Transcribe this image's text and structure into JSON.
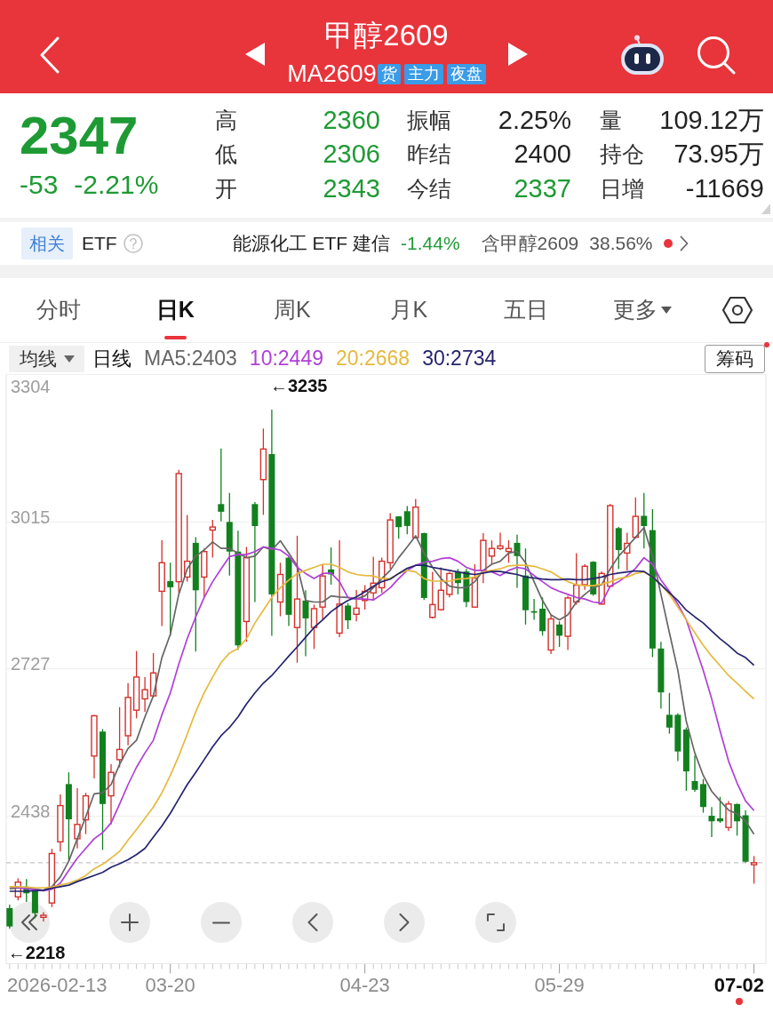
{
  "header": {
    "title": "甲醇2609",
    "code": "MA2609",
    "badges": [
      "货",
      "主力",
      "夜盘"
    ]
  },
  "quote": {
    "price": "2347",
    "change": "-53",
    "change_pct": "-2.21%",
    "down": true,
    "stats": [
      {
        "label": "高",
        "value": "2360",
        "color": "#1e9a34"
      },
      {
        "label": "振幅",
        "value": "2.25%",
        "color": "#222222"
      },
      {
        "label": "量",
        "value": "109.12万",
        "color": "#222222"
      },
      {
        "label": "低",
        "value": "2306",
        "color": "#1e9a34"
      },
      {
        "label": "昨结",
        "value": "2400",
        "color": "#222222"
      },
      {
        "label": "持仓",
        "value": "73.95万",
        "color": "#222222"
      },
      {
        "label": "开",
        "value": "2343",
        "color": "#1e9a34"
      },
      {
        "label": "今结",
        "value": "2337",
        "color": "#1e9a34"
      },
      {
        "label": "日增",
        "value": "-11669",
        "color": "#222222"
      }
    ]
  },
  "etf": {
    "tag": "相关",
    "label": "ETF",
    "fund": "能源化工 ETF 建信",
    "change": "-1.44%",
    "down": true,
    "holding": "含甲醇2609",
    "weight": "38.56%",
    "alert": true
  },
  "tabs": [
    {
      "label": "分时",
      "selected": false,
      "kind": "tab"
    },
    {
      "label": "日K",
      "selected": true,
      "kind": "tab"
    },
    {
      "label": "周K",
      "selected": false,
      "kind": "tab"
    },
    {
      "label": "月K",
      "selected": false,
      "kind": "tab"
    },
    {
      "label": "五日",
      "selected": false,
      "kind": "tab"
    },
    {
      "label": "更多",
      "selected": false,
      "kind": "menu"
    }
  ],
  "chart": {
    "selector": "均线",
    "period": "日线",
    "chip_button": {
      "label": "筹码",
      "alert": true
    },
    "start_date": "2026-02-13",
    "end_date": "07-02",
    "current_marker": true,
    "controls": [
      {
        "kind": "rewind"
      },
      {
        "kind": "zoom-in"
      },
      {
        "kind": "zoom-out"
      },
      {
        "kind": "back"
      },
      {
        "kind": "forward"
      },
      {
        "kind": "fullscreen"
      }
    ],
    "chart_data": {
      "type": "candlestick",
      "grid": true,
      "ylim": [
        2149,
        3304
      ],
      "yticks": [
        3304,
        3015,
        2727,
        2438
      ],
      "categories": [
        null,
        null,
        null,
        null,
        null,
        null,
        null,
        null,
        null,
        null,
        null,
        null,
        null,
        null,
        null,
        null,
        null,
        null,
        null,
        "03-20",
        null,
        null,
        null,
        null,
        null,
        null,
        null,
        null,
        null,
        null,
        null,
        null,
        null,
        null,
        null,
        null,
        null,
        null,
        null,
        null,
        null,
        null,
        "04-23",
        null,
        null,
        null,
        null,
        null,
        null,
        null,
        null,
        null,
        null,
        null,
        null,
        null,
        null,
        null,
        null,
        null,
        null,
        null,
        null,
        null,
        null,
        "05-29",
        null,
        null,
        null,
        null,
        null,
        null,
        null,
        null,
        null,
        null,
        null,
        null,
        null,
        null,
        null,
        null,
        null,
        null,
        null,
        null,
        null,
        null,
        null
      ],
      "annotations": [
        "←3235",
        "←2218"
      ],
      "ref_lines": [
        {
          "axis": "y",
          "value": 2347
        }
      ],
      "series": [
        {
          "name": "MA5:2403",
          "type": "line",
          "color": "#666666",
          "values": [
            2296,
            2297,
            2298,
            2295,
            2293,
            2300,
            2319,
            2350,
            2394,
            2437,
            2482,
            2484,
            2500,
            2540,
            2571,
            2587,
            2633,
            2674,
            2749,
            2795,
            2873,
            2923,
            2948,
            2960,
            2976,
            2963,
            2963,
            2954,
            2945,
            2948,
            2966,
            2960,
            2978,
            2954,
            2929,
            2861,
            2858,
            2858,
            2870,
            2868,
            2867,
            2864,
            2870,
            2886,
            2904,
            2920,
            2945,
            2966,
            2988,
            2954,
            2926,
            2904,
            2889,
            2886,
            2886,
            2898,
            2920,
            2932,
            2938,
            2954,
            2957,
            2935,
            2898,
            2861,
            2833,
            2823,
            2833,
            2858,
            2873,
            2886,
            2892,
            2923,
            2948,
            2966,
            2985,
            3004,
            2948,
            2873,
            2798,
            2724,
            2624,
            2562,
            2518,
            2487,
            2468,
            2450,
            2443,
            2428,
            2403
          ]
        },
        {
          "name": "10:2449",
          "type": "line",
          "color": "#b03fd8",
          "values": [
            2300,
            2298,
            2296,
            2294,
            2292,
            2295,
            2307,
            2332,
            2356,
            2375,
            2394,
            2406,
            2425,
            2462,
            2500,
            2534,
            2562,
            2587,
            2637,
            2680,
            2736,
            2786,
            2829,
            2867,
            2898,
            2923,
            2947,
            2951,
            2951,
            2957,
            2966,
            2963,
            2960,
            2948,
            2926,
            2914,
            2904,
            2914,
            2915,
            2898,
            2867,
            2864,
            2864,
            2862,
            2873,
            2886,
            2904,
            2920,
            2930,
            2936,
            2938,
            2943,
            2945,
            2938,
            2926,
            2920,
            2920,
            2917,
            2910,
            2920,
            2926,
            2923,
            2910,
            2898,
            2886,
            2879,
            2873,
            2867,
            2864,
            2858,
            2856,
            2889,
            2898,
            2910,
            2924,
            2945,
            2932,
            2901,
            2879,
            2854,
            2823,
            2773,
            2724,
            2668,
            2605,
            2546,
            2503,
            2468,
            2449
          ]
        },
        {
          "name": "20:2668",
          "type": "line",
          "color": "#e6b93e",
          "values": [
            2300,
            2300,
            2299,
            2298,
            2298,
            2299,
            2303,
            2307,
            2313,
            2322,
            2335,
            2344,
            2356,
            2369,
            2391,
            2412,
            2434,
            2456,
            2484,
            2518,
            2556,
            2599,
            2643,
            2680,
            2711,
            2739,
            2758,
            2767,
            2786,
            2817,
            2842,
            2867,
            2886,
            2901,
            2914,
            2920,
            2926,
            2932,
            2932,
            2926,
            2917,
            2912,
            2910,
            2909,
            2904,
            2904,
            2914,
            2920,
            2917,
            2904,
            2899,
            2899,
            2899,
            2903,
            2904,
            2907,
            2917,
            2920,
            2923,
            2929,
            2930,
            2930,
            2928,
            2923,
            2917,
            2907,
            2898,
            2892,
            2890,
            2890,
            2893,
            2898,
            2904,
            2907,
            2914,
            2917,
            2907,
            2892,
            2873,
            2848,
            2823,
            2798,
            2773,
            2752,
            2733,
            2714,
            2699,
            2683,
            2668
          ]
        },
        {
          "name": "30:2734",
          "type": "line",
          "color": "#24246e",
          "values": [
            2291,
            2291,
            2291,
            2292,
            2293,
            2297,
            2300,
            2303,
            2310,
            2316,
            2322,
            2328,
            2338,
            2345,
            2353,
            2363,
            2375,
            2397,
            2419,
            2444,
            2472,
            2500,
            2524,
            2549,
            2574,
            2596,
            2612,
            2633,
            2658,
            2680,
            2699,
            2714,
            2733,
            2752,
            2770,
            2789,
            2808,
            2823,
            2839,
            2851,
            2861,
            2868,
            2878,
            2889,
            2898,
            2903,
            2914,
            2924,
            2930,
            2930,
            2926,
            2923,
            2920,
            2917,
            2914,
            2912,
            2915,
            2918,
            2918,
            2915,
            2912,
            2907,
            2905,
            2903,
            2902,
            2902,
            2903,
            2902,
            2902,
            2904,
            2907,
            2912,
            2915,
            2917,
            2919,
            2918,
            2907,
            2892,
            2876,
            2861,
            2842,
            2829,
            2817,
            2801,
            2786,
            2773,
            2758,
            2749,
            2734
          ]
        }
      ],
      "ohlc": [
        [
          2258,
          2265,
          2218,
          2222
        ],
        [
          2280,
          2316,
          2273,
          2309
        ],
        [
          2300,
          2315,
          2270,
          2287
        ],
        [
          2292,
          2295,
          2238,
          2248
        ],
        [
          2240,
          2250,
          2232,
          2244
        ],
        [
          2268,
          2374,
          2260,
          2365
        ],
        [
          2388,
          2481,
          2369,
          2459
        ],
        [
          2501,
          2524,
          2350,
          2432
        ],
        [
          2394,
          2493,
          2375,
          2422
        ],
        [
          2431,
          2484,
          2403,
          2478
        ],
        [
          2556,
          2637,
          2512,
          2635
        ],
        [
          2604,
          2609,
          2372,
          2462
        ],
        [
          2478,
          2540,
          2422,
          2524
        ],
        [
          2549,
          2652,
          2534,
          2569
        ],
        [
          2596,
          2699,
          2577,
          2671
        ],
        [
          2646,
          2762,
          2630,
          2711
        ],
        [
          2668,
          2711,
          2643,
          2686
        ],
        [
          2674,
          2758,
          2671,
          2719
        ],
        [
          2879,
          2979,
          2811,
          2935
        ],
        [
          2899,
          2935,
          2792,
          2887
        ],
        [
          2898,
          3117,
          2876,
          3110
        ],
        [
          2907,
          3029,
          2898,
          2938
        ],
        [
          2974,
          2985,
          2761,
          2881
        ],
        [
          2907,
          2963,
          2867,
          2957
        ],
        [
          2999,
          3019,
          2945,
          3005
        ],
        [
          3050,
          3159,
          3016,
          3035
        ],
        [
          3015,
          3072,
          2910,
          2957
        ],
        [
          2957,
          2998,
          2764,
          2773
        ],
        [
          2820,
          2966,
          2780,
          2945
        ],
        [
          3050,
          3054,
          2858,
          3007
        ],
        [
          3098,
          3198,
          3029,
          3158
        ],
        [
          3148,
          3235,
          2792,
          2873
        ],
        [
          2858,
          2935,
          2830,
          2912
        ],
        [
          2945,
          2948,
          2811,
          2833
        ],
        [
          2808,
          2988,
          2739,
          2864
        ],
        [
          2861,
          2881,
          2752,
          2826
        ],
        [
          2808,
          2853,
          2766,
          2845
        ],
        [
          2848,
          2932,
          2823,
          2909
        ],
        [
          2922,
          2965,
          2892,
          2912
        ],
        [
          2797,
          2979,
          2789,
          2854
        ],
        [
          2851,
          2856,
          2805,
          2822
        ],
        [
          2834,
          2882,
          2820,
          2846
        ],
        [
          2861,
          2891,
          2843,
          2879
        ],
        [
          2876,
          2947,
          2861,
          2895
        ],
        [
          2886,
          2945,
          2876,
          2938
        ],
        [
          2935,
          3032,
          2923,
          3019
        ],
        [
          3026,
          3026,
          2982,
          3005
        ],
        [
          3036,
          3046,
          2991,
          3007
        ],
        [
          2984,
          3060,
          2982,
          3044
        ],
        [
          2993,
          2994,
          2862,
          2866
        ],
        [
          2828,
          2917,
          2826,
          2853
        ],
        [
          2843,
          2926,
          2841,
          2881
        ],
        [
          2873,
          2917,
          2867,
          2914
        ],
        [
          2917,
          2923,
          2873,
          2895
        ],
        [
          2918,
          2923,
          2848,
          2858
        ],
        [
          2848,
          2932,
          2847,
          2905
        ],
        [
          2920,
          2993,
          2895,
          2979
        ],
        [
          2948,
          2979,
          2932,
          2963
        ],
        [
          2963,
          2994,
          2960,
          2968
        ],
        [
          2957,
          2979,
          2935,
          2963
        ],
        [
          2974,
          2990,
          2886,
          2948
        ],
        [
          2910,
          2963,
          2814,
          2842
        ],
        [
          2840,
          2864,
          2823,
          2837
        ],
        [
          2845,
          2867,
          2792,
          2801
        ],
        [
          2764,
          2833,
          2756,
          2825
        ],
        [
          2814,
          2820,
          2770,
          2792
        ],
        [
          2791,
          2870,
          2764,
          2866
        ],
        [
          2858,
          2954,
          2853,
          2891
        ],
        [
          2892,
          2932,
          2882,
          2928
        ],
        [
          2937,
          2938,
          2870,
          2873
        ],
        [
          2854,
          2918,
          2853,
          2914
        ],
        [
          2889,
          3050,
          2887,
          3047
        ],
        [
          3003,
          3005,
          2923,
          2960
        ],
        [
          2954,
          2994,
          2920,
          2973
        ],
        [
          2985,
          3063,
          2982,
          3026
        ],
        [
          3027,
          3072,
          2963,
          3007
        ],
        [
          2999,
          3040,
          2750,
          2767
        ],
        [
          2767,
          2780,
          2649,
          2681
        ],
        [
          2637,
          2680,
          2600,
          2612
        ],
        [
          2637,
          2640,
          2546,
          2565
        ],
        [
          2608,
          2612,
          2488,
          2526
        ],
        [
          2507,
          2557,
          2486,
          2490
        ],
        [
          2501,
          2511,
          2445,
          2456
        ],
        [
          2439,
          2456,
          2397,
          2428
        ],
        [
          2434,
          2476,
          2425,
          2428
        ],
        [
          2416,
          2468,
          2409,
          2462
        ],
        [
          2462,
          2463,
          2400,
          2428
        ],
        [
          2440,
          2450,
          2347,
          2349
        ],
        [
          2343,
          2360,
          2306,
          2347
        ]
      ]
    }
  }
}
